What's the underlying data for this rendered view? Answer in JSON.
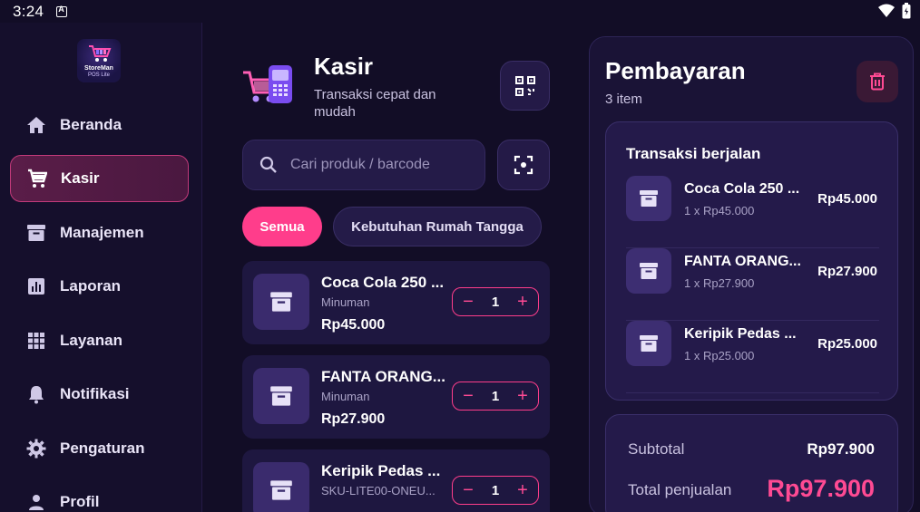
{
  "status_bar": {
    "time": "3:24"
  },
  "sidebar": {
    "logo": {
      "line1": "StoreMan",
      "line2": "POS Lite"
    },
    "items": [
      {
        "label": "Beranda",
        "icon": "home-icon",
        "active": false
      },
      {
        "label": "Kasir",
        "icon": "cart-icon",
        "active": true
      },
      {
        "label": "Manajemen",
        "icon": "archive-icon",
        "active": false
      },
      {
        "label": "Laporan",
        "icon": "bar-chart-icon",
        "active": false
      },
      {
        "label": "Layanan",
        "icon": "apps-grid-icon",
        "active": false
      },
      {
        "label": "Notifikasi",
        "icon": "bell-icon",
        "active": false
      },
      {
        "label": "Pengaturan",
        "icon": "gear-icon",
        "active": false
      },
      {
        "label": "Profil",
        "icon": "person-icon",
        "active": false
      }
    ]
  },
  "kasir": {
    "title": "Kasir",
    "subtitle": "Transaksi cepat dan mudah",
    "search_placeholder": "Cari produk / barcode",
    "categories": [
      {
        "label": "Semua",
        "active": true
      },
      {
        "label": "Kebutuhan Rumah Tangga",
        "active": false
      }
    ],
    "products": [
      {
        "name": "Coca Cola 250 ...",
        "category": "Minuman",
        "price": "Rp45.000",
        "qty": "1"
      },
      {
        "name": "FANTA ORANG...",
        "category": "Minuman",
        "price": "Rp27.900",
        "qty": "1"
      },
      {
        "name": "Keripik Pedas ...",
        "category": "SKU-LITE00-ONEU...",
        "price": "",
        "qty": "1"
      }
    ]
  },
  "payment": {
    "title": "Pembayaran",
    "item_count": "3 item",
    "running_title": "Transaksi berjalan",
    "items": [
      {
        "name": "Coca Cola 250 ...",
        "qty_price": "1 x Rp45.000",
        "total": "Rp45.000"
      },
      {
        "name": "FANTA ORANG...",
        "qty_price": "1 x Rp27.900",
        "total": "Rp27.900"
      },
      {
        "name": "Keripik Pedas ...",
        "qty_price": "1 x Rp25.000",
        "total": "Rp25.000"
      }
    ],
    "subtotal_label": "Subtotal",
    "subtotal_value": "Rp97.900",
    "total_label": "Total penjualan",
    "total_value": "Rp97.900"
  },
  "colors": {
    "accent": "#ff3d8b",
    "background": "#120d26",
    "card": "#1e1740"
  }
}
